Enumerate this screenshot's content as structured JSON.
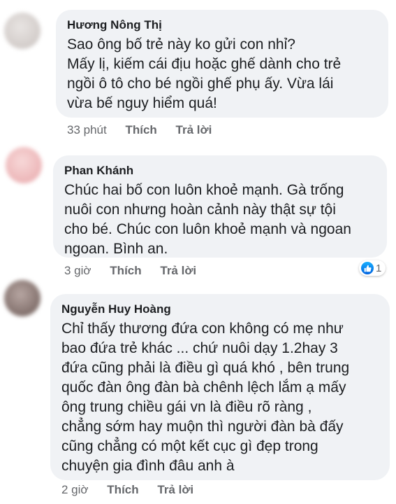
{
  "comments": [
    {
      "author": "Hương Nông Thị",
      "lines": [
        "Sao ông bố trẻ này ko gửi con nhỉ?",
        "Mấy lị, kiếm cái địu hoặc ghế dành cho trẻ",
        "ngồi ô tô cho bé ngồi ghế phụ ấy. Vừa lái",
        "vừa bế nguy hiểm quá!"
      ],
      "time": "33 phút",
      "like_label": "Thích",
      "reply_label": "Trả lời"
    },
    {
      "author": "Phan Khánh",
      "lines": [
        "Chúc hai bố con luôn khoẻ mạnh. Gà trống",
        "nuôi con nhưng hoàn cảnh này thật sự tội",
        "cho bé. Chúc con luôn khoẻ mạnh và ngoan",
        "ngoan. Bình an."
      ],
      "time": "3 giờ",
      "like_label": "Thích",
      "reply_label": "Trả lời",
      "reaction_count": "1"
    },
    {
      "author": "Nguyễn Huy Hoàng",
      "lines": [
        "Chỉ thấy thương đứa con không có mẹ như",
        "bao đứa trẻ khác ... chứ nuôi dạy 1.2hay 3",
        "đứa cũng phải là điều gì quá khó , bên trung",
        "quốc đàn ông đàn bà chênh lệch lắm ạ mấy",
        "ông trung chiều gái vn là điều rõ ràng ,",
        "chẳng sớm hay muộn thì người đàn bà đấy",
        "cũng chẳng có một kết cục gì đẹp trong",
        "chuyện gia đình đâu anh à"
      ],
      "time": "2 giờ",
      "like_label": "Thích",
      "reply_label": "Trả lời"
    }
  ],
  "colors": {
    "bubble": "#f0f2f5",
    "meta": "#65676b",
    "like_blue": "#1877f2"
  }
}
